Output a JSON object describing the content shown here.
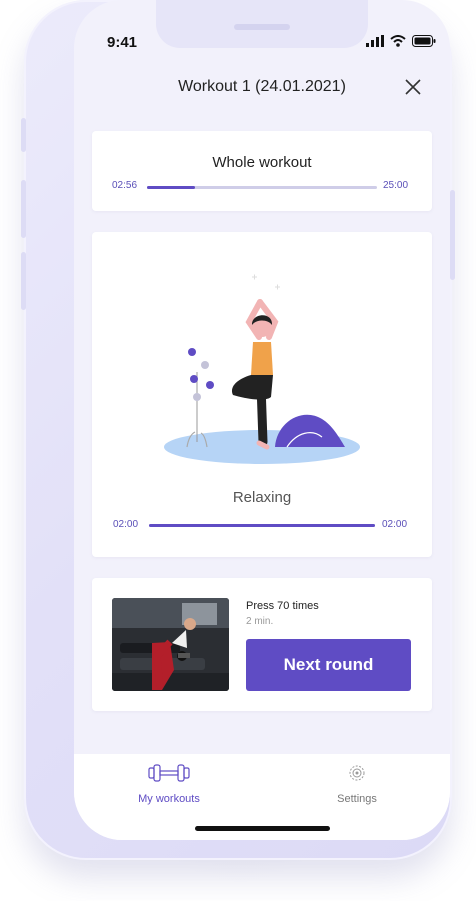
{
  "status_bar": {
    "time": "9:41"
  },
  "header": {
    "title": "Workout  1 (24.01.2021)"
  },
  "whole_workout": {
    "title": "Whole workout",
    "elapsed": "02:56",
    "total": "25:00",
    "progress": 0.21
  },
  "current_exercise": {
    "name": "Relaxing",
    "elapsed": "02:00",
    "total": "02:00",
    "progress": 1.0
  },
  "next_round": {
    "title": "Press 70 times",
    "duration": "2 min.",
    "button_label": "Next round"
  },
  "tabs": [
    {
      "label": "My workouts",
      "active": true
    },
    {
      "label": "Settings",
      "active": false
    }
  ],
  "colors": {
    "accent": "#5f4cc4",
    "track": "#cfcde8",
    "inactive_tab": "#777777"
  }
}
